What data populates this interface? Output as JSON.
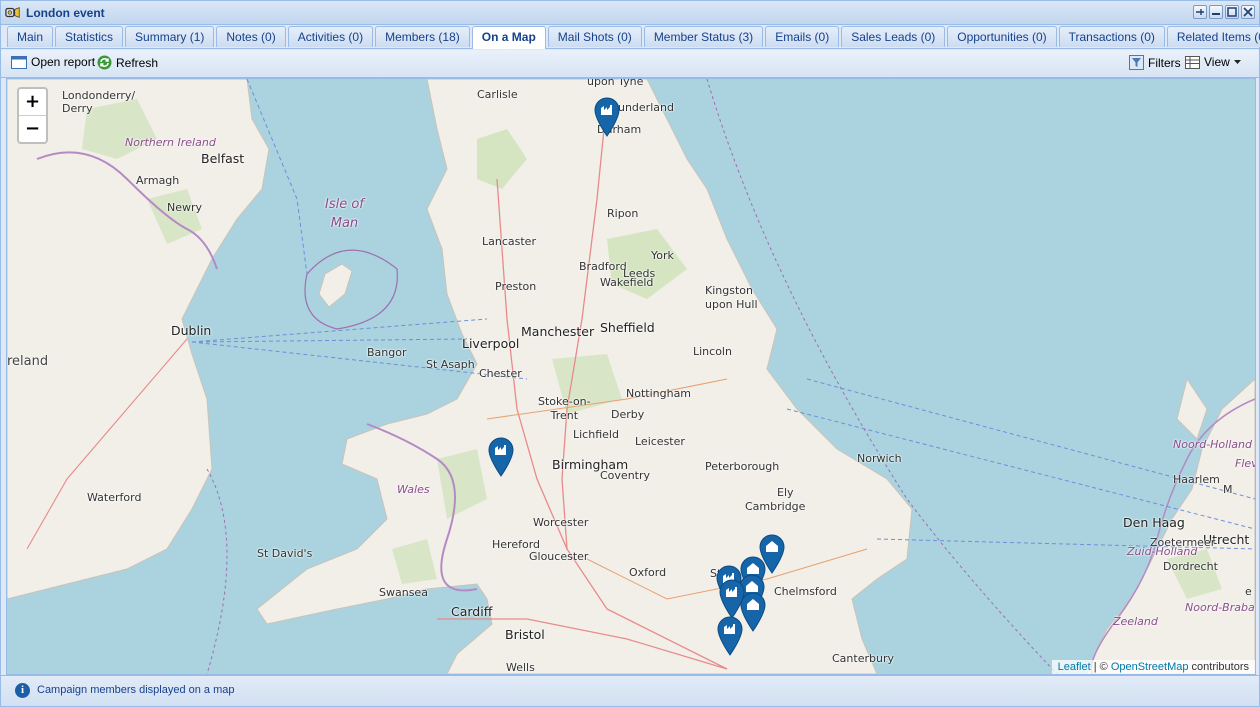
{
  "window": {
    "title": "London event"
  },
  "tabs": [
    {
      "label": "Main"
    },
    {
      "label": "Statistics"
    },
    {
      "label": "Summary (1)"
    },
    {
      "label": "Notes (0)"
    },
    {
      "label": "Activities (0)"
    },
    {
      "label": "Members (18)"
    },
    {
      "label": "On a Map",
      "active": true
    },
    {
      "label": "Mail Shots (0)"
    },
    {
      "label": "Member Status (3)"
    },
    {
      "label": "Emails (0)"
    },
    {
      "label": "Sales Leads (0)"
    },
    {
      "label": "Opportunities (0)"
    },
    {
      "label": "Transactions (0)"
    },
    {
      "label": "Related Items (0)"
    }
  ],
  "toolbar": {
    "open_report": "Open report",
    "refresh": "Refresh",
    "filters": "Filters",
    "view": "View"
  },
  "map": {
    "zoom_in": "+",
    "zoom_out": "−",
    "attribution": {
      "leaflet": "Leaflet",
      "sep": " | © ",
      "osm": "OpenStreetMap",
      "contrib": " contributors"
    },
    "labels": {
      "upon_tyne": "upon Tyne",
      "sunderland": "Sunderland",
      "durham": "Durham",
      "carlisle": "Carlisle",
      "londonderry": "Londonderry/\nDerry",
      "northern_ireland": "Northern Ireland",
      "belfast": "Belfast",
      "armagh": "Armagh",
      "newry": "Newry",
      "isle_of_man": "Isle of\nMan",
      "ripon": "Ripon",
      "lancaster": "Lancaster",
      "york": "York",
      "bradford": "Bradford",
      "leeds": "Leeds",
      "wakefield": "Wakefield",
      "preston": "Preston",
      "kingston": "Kingston\nupon Hull",
      "manchester": "Manchester",
      "sheffield": "Sheffield",
      "dublin": "Dublin",
      "liverpool": "Liverpool",
      "ireland": "reland",
      "bangor": "Bangor",
      "st_asaph": "St Asaph",
      "lincoln": "Lincoln",
      "chester": "Chester",
      "nottingham": "Nottingham",
      "stoke": "Stoke-on-\nTrent",
      "derby": "Derby",
      "lichfield": "Lichfield",
      "leicester": "Leicester",
      "birmingham": "Birmingham",
      "coventry": "Coventry",
      "peterborough": "Peterborough",
      "norwich": "Norwich",
      "wales": "Wales",
      "waterford": "Waterford",
      "ely": "Ely",
      "cambridge": "Cambridge",
      "worcester": "Worcester",
      "hereford": "Hereford",
      "gloucester": "Gloucester",
      "st_davids": "St David's",
      "oxford": "Oxford",
      "chelmsford": "Chelmsford",
      "swansea": "Swansea",
      "cardiff": "Cardiff",
      "bristol": "Bristol",
      "wells": "Wells",
      "canterbury": "Canterbury",
      "noord_holland": "Noord-Holland",
      "haarlem": "Haarlem",
      "den_haag": "Den Haag",
      "utrecht": "Utrecht",
      "zoetermeer": "Zoetermeer",
      "zuid_holland": "Zuid-Holland",
      "dordrecht": "Dordrecht",
      "noord_brabant": "Noord-Brabant",
      "zeeland": "Zeeland",
      "st": "St",
      "m": "M",
      "flev": "Flev",
      "e": "e"
    }
  },
  "status": {
    "text": "Campaign members displayed on a map"
  },
  "colors": {
    "marker": "#1565a8",
    "sea": "#aad3df",
    "land": "#f2efe9",
    "border": "#9e6fb0"
  }
}
